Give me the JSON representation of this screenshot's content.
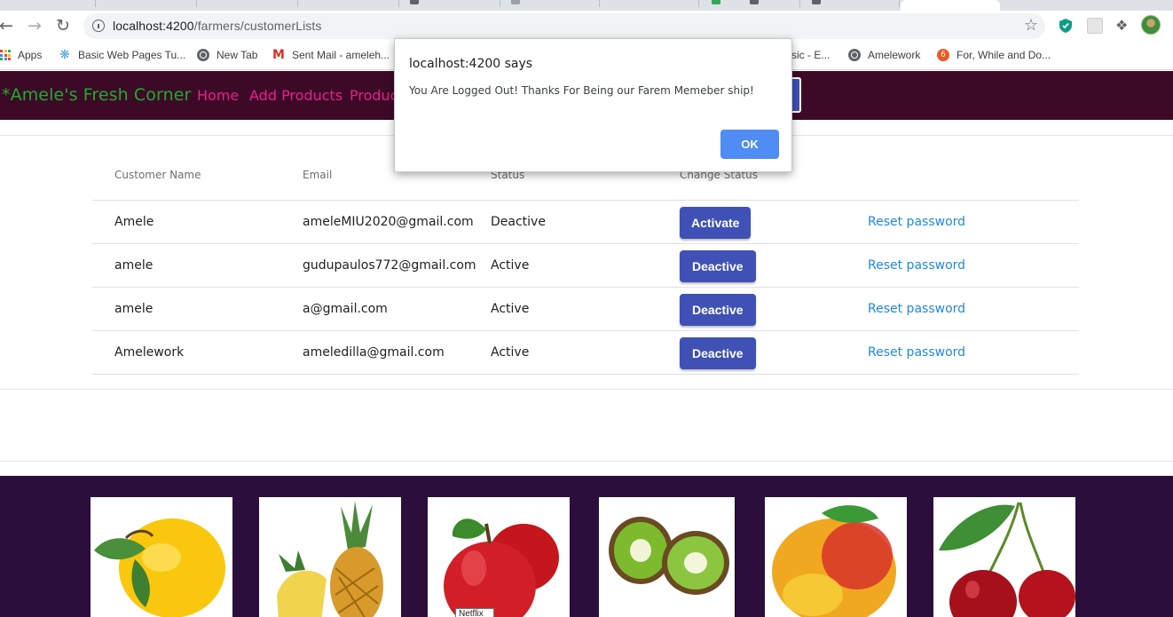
{
  "browser": {
    "url_host": "localhost:4200",
    "url_path": "/farmers/customerLists",
    "bookmarks": [
      {
        "label": "Apps",
        "icon": "apps-grid-icon"
      },
      {
        "label": "Basic Web Pages Tu...",
        "icon": "fan-icon"
      },
      {
        "label": "New Tab",
        "icon": "globe-icon"
      },
      {
        "label": "Sent Mail - ameleh...",
        "icon": "gmail-icon"
      },
      {
        "label": "sic - E...",
        "icon": "none"
      },
      {
        "label": "Amelework",
        "icon": "globe-icon"
      },
      {
        "label": "For, While and Do...",
        "icon": "orange-icon"
      }
    ]
  },
  "header": {
    "brand": "*Amele's Fresh Corner",
    "nav": [
      "Home",
      "Add Products",
      "Produc"
    ]
  },
  "table": {
    "columns": [
      "Customer Name",
      "Email",
      "Status",
      "Change Status"
    ],
    "rows": [
      {
        "name": "Amele",
        "email": "ameleMIU2020@gmail.com",
        "status": "Deactive",
        "action": "Activate",
        "reset": "Reset password"
      },
      {
        "name": "amele",
        "email": "gudupaulos772@gmail.com",
        "status": "Active",
        "action": "Deactive",
        "reset": "Reset password"
      },
      {
        "name": "amele",
        "email": "a@gmail.com",
        "status": "Active",
        "action": "Deactive",
        "reset": "Reset password"
      },
      {
        "name": "Amelework",
        "email": "ameledilla@gmail.com",
        "status": "Active",
        "action": "Deactive",
        "reset": "Reset password"
      }
    ]
  },
  "gallery": {
    "items": [
      "lemon-image",
      "pineapple-image",
      "apple-image",
      "kiwi-image",
      "mango-image",
      "cherry-image"
    ],
    "tooltip": "Netflix"
  },
  "dialog": {
    "title": "localhost:4200 says",
    "message": "You Are Logged Out! Thanks For Being our Farem Memeber ship!",
    "ok_label": "OK"
  },
  "colors": {
    "header_bg": "#3c0a27",
    "brand": "#1fab2e",
    "nav_link": "#e91e8c",
    "primary_button": "#3f51b5",
    "link": "#1e88e5",
    "gallery_bg": "#2c0e3d",
    "dialog_ok": "#4f8cf4"
  }
}
